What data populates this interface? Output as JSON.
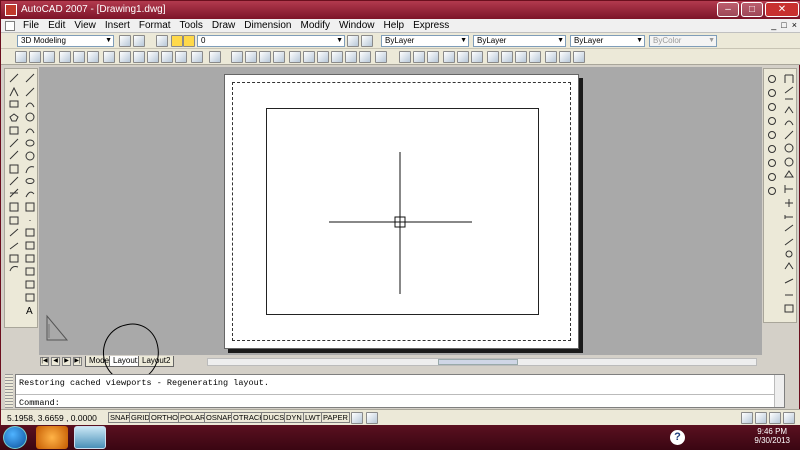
{
  "window": {
    "title": "AutoCAD 2007 - [Drawing1.dwg]",
    "buttons": [
      "–",
      "□",
      "✕"
    ]
  },
  "menubar": {
    "items": [
      "File",
      "Edit",
      "View",
      "Insert",
      "Format",
      "Tools",
      "Draw",
      "Dimension",
      "Modify",
      "Window",
      "Help",
      "Express"
    ],
    "doc_controls": [
      "_",
      "□",
      "×"
    ]
  },
  "toolbar1": {
    "workspace": "3D Modeling",
    "layer": "0",
    "color": "ByLayer",
    "linetype": "ByLayer",
    "lineweight": "ByLayer",
    "plotstyle": "ByColor"
  },
  "layout_tabs": [
    "Model",
    "Layout1",
    "Layout2"
  ],
  "command": {
    "history": "Restoring cached viewports - Regenerating layout.",
    "prompt": "Command:"
  },
  "status": {
    "coords": "5.1958, 3.6659 , 0.0000",
    "toggles": [
      "SNAP",
      "GRID",
      "ORTHO",
      "POLAR",
      "OSNAP",
      "OTRACK",
      "DUCS",
      "DYN",
      "LWT",
      "PAPER"
    ]
  },
  "taskbar": {
    "time": "9:46 PM",
    "date": "9/30/2013",
    "help": "?"
  },
  "colors": {
    "title_bar": "#7c1428",
    "canvas_bg": "#a9a9a9",
    "paper": "#ffffff",
    "desktop": "#6b0f1e"
  },
  "icons": {
    "draw_toolbar": [
      "line-icon",
      "construction-line-icon",
      "polyline-icon",
      "polygon-icon",
      "rectangle-icon",
      "arc-icon",
      "circle-icon",
      "revision-cloud-icon",
      "spline-icon",
      "ellipse-icon",
      "ellipse-arc-icon",
      "insert-block-icon",
      "make-block-icon",
      "point-icon",
      "hatch-icon",
      "gradient-icon",
      "region-icon",
      "table-icon",
      "multiline-text-icon"
    ],
    "modify_toolbar": [
      "erase-icon",
      "copy-icon",
      "mirror-icon",
      "offset-icon",
      "array-icon",
      "move-icon",
      "rotate-icon",
      "scale-icon",
      "stretch-icon",
      "trim-icon",
      "extend-icon",
      "break-at-point-icon",
      "break-icon",
      "join-icon",
      "chamfer-icon",
      "fillet-icon",
      "explode-icon"
    ]
  }
}
